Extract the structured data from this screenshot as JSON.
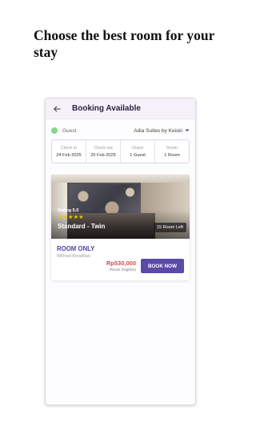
{
  "headline": "Choose the best room for your stay",
  "appbar": {
    "title": "Booking Available"
  },
  "guest": {
    "label": "Guest",
    "hotel": "Adia Suites by Keiski"
  },
  "booking": {
    "cells": [
      {
        "label": "Check in",
        "value": "24 Feb 2025"
      },
      {
        "label": "Check out",
        "value": "25 Feb 2025"
      },
      {
        "label": "Guest",
        "value": "1 Guest"
      },
      {
        "label": "Room",
        "value": "1 Room"
      }
    ]
  },
  "room": {
    "rating": "Rating 5.0",
    "stars": "★★★★★",
    "star_count": 5,
    "name": "Standard - Twin",
    "rooms_left": "15 Room Left",
    "plan": "ROOM ONLY",
    "plan_note": "Without Breakfast",
    "price": "Rp530,000",
    "price_unit": "/Room /Night(s)",
    "book_label": "BOOK NOW"
  },
  "colors": {
    "accent": "#5b4aa8",
    "price": "#e04848",
    "guest_dot": "#8bd38b",
    "stars": "#f2c200"
  },
  "icons": {
    "back": "back-arrow-icon",
    "dropdown": "caret-down-icon"
  }
}
